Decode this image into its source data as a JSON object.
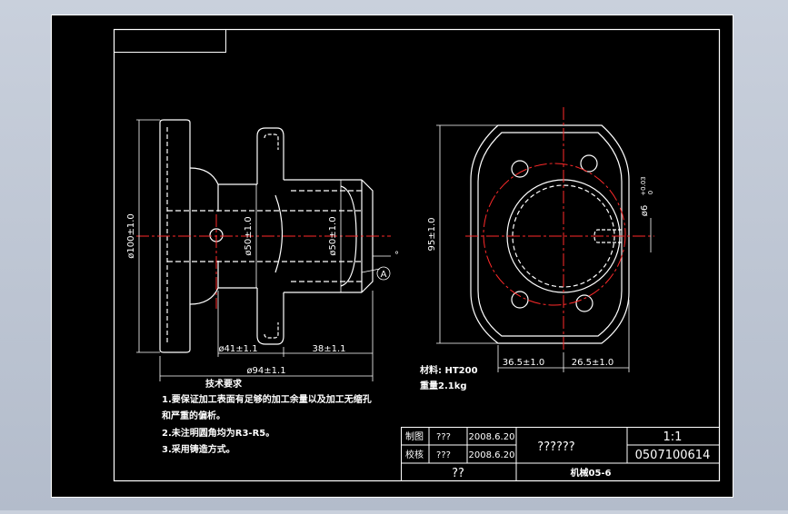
{
  "colors": {
    "background": "#c9d0dc",
    "paper": "#000000",
    "line": "#ffffff",
    "center_line": "#ff2a2a",
    "dimension": "#ffffff"
  },
  "dimensions": {
    "od100": "ø100±1.0",
    "od50_left": "ø50±1.0",
    "od50_right": "ø50±1.0",
    "len41": "ø41±1.1",
    "len38": "38±1.1",
    "len94": "ø94±1.1",
    "h95": "95±1.0",
    "w365": "36.5±1.0",
    "w265": "26.5±1.0",
    "hole6": "ø6",
    "hole6_tol_up": "+0.03",
    "hole6_tol_low": "0",
    "callout_a": "A",
    "small_mark": "°"
  },
  "material": {
    "material_label": "材料: HT200",
    "weight_label": "重量2.1kg"
  },
  "notes": {
    "heading": "技术要求",
    "line1": "1.要保证加工表面有足够的加工余量以及加工无缩孔",
    "line1b": "和严重的偏析。",
    "line2": "2.未注明圆角均为R3-R5。",
    "line3": "3.采用铸造方式。"
  },
  "title_block": {
    "row1_role": "制图",
    "row1_name": "???",
    "row1_date": "2008.6.20",
    "row2_role": "校核",
    "row2_name": "???",
    "row2_date": "2008.6.20",
    "part_name": "??????",
    "scale": "1:1",
    "drawing_no": "0507100614",
    "bottom_left": "??",
    "bottom_right": "机械05-6"
  }
}
